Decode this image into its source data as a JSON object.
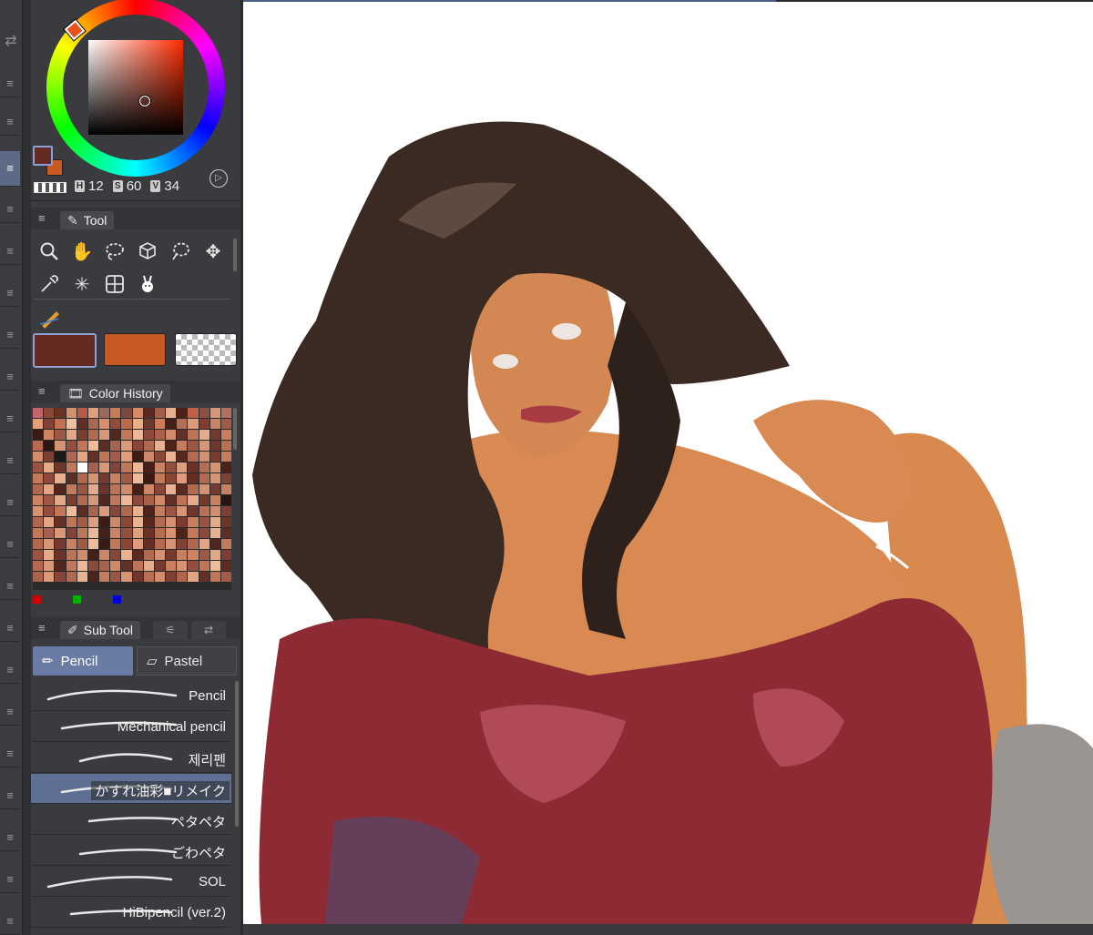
{
  "color_wheel": {
    "h_label": "H",
    "h_value": "12",
    "s_label": "S",
    "s_value": "60",
    "v_label": "V",
    "v_value": "34",
    "main_color": "#652b22",
    "sub_color": "#c85a26"
  },
  "tool_panel": {
    "tab_label": "Tool",
    "tools": [
      "zoom-icon",
      "hand-icon",
      "lasso-select-icon",
      "3d-object-icon",
      "lasso-fill-icon",
      "move-icon",
      "eyedropper-icon",
      "auto-select-icon",
      "frame-border-icon",
      "rabbit-icon"
    ]
  },
  "color_history": {
    "tab_label": "Color History",
    "swatches": [
      "#c2666c",
      "#8a4a3a",
      "#6b3326",
      "#d4906a",
      "#b85a48",
      "#e0a080",
      "#9a6b5c",
      "#c87a5a",
      "#7a4a42",
      "#d68a6a",
      "#5a2a22",
      "#a0604a",
      "#e6b090",
      "#4a2018",
      "#c06048",
      "#8e5040",
      "#d49878",
      "#b07060",
      "#e4a07a",
      "#7e4236",
      "#c27052",
      "#f0c0a0",
      "#5e3028",
      "#a86850",
      "#d8906c",
      "#924c3a",
      "#ba6a4e",
      "#e8b088",
      "#6a3a30",
      "#cc7c5c",
      "#402018",
      "#b0705a",
      "#dc9c7c",
      "#843c2e",
      "#c88666",
      "#a05a48",
      "#3a1a14",
      "#cc8462",
      "#9e5846",
      "#e0a886",
      "#7a3e32",
      "#b46a52",
      "#d6987a",
      "#52281e",
      "#c0785c",
      "#ecb898",
      "#8c4a3c",
      "#a8624c",
      "#d08a6a",
      "#60302a",
      "#bc7458",
      "#e4ac8c",
      "#743a2e",
      "#c8805e",
      "#b86a50",
      "#2e1612",
      "#d49474",
      "#924e3e",
      "#c27656",
      "#f0bc98",
      "#5a2c24",
      "#a6644e",
      "#da9a7a",
      "#88463a",
      "#b0684e",
      "#e6b292",
      "#4c241c",
      "#c47c5e",
      "#9c5646",
      "#d69676",
      "#6e362c",
      "#ba7052",
      "#d28e6c",
      "#7c4034",
      "#1a1a1a",
      "#ae664e",
      "#e2a684",
      "#643026",
      "#c07656",
      "#a25c48",
      "#de9e7e",
      "#3e1c16",
      "#cc8868",
      "#8a4838",
      "#e8b494",
      "#56281e",
      "#b26c54",
      "#d49070",
      "#7a3c30",
      "#c4805e",
      "#9a5242",
      "#e2aa88",
      "#6c362a",
      "#c07a5a",
      "#ffffff",
      "#a46050",
      "#d89878",
      "#80423a",
      "#bc7658",
      "#eab898",
      "#46201a",
      "#c88464",
      "#92503e",
      "#dca080",
      "#683228",
      "#b66e52",
      "#d89472",
      "#4a2418",
      "#c27a5a",
      "#8c4a3c",
      "#e6b08e",
      "#5c2e26",
      "#b0684e",
      "#d49676",
      "#763a30",
      "#c88262",
      "#a05a46",
      "#ecbc9c",
      "#3a1a14",
      "#c07858",
      "#8a4636",
      "#de9c7c",
      "#622e26",
      "#b46a50",
      "#d69474",
      "#7e4236",
      "#ae6850",
      "#e0a482",
      "#52261e",
      "#c27c5c",
      "#9a5444",
      "#e4aa8a",
      "#6a342a",
      "#bc7456",
      "#d08c6c",
      "#442018",
      "#cc8666",
      "#884638",
      "#e8b292",
      "#5a2a22",
      "#b06a52",
      "#d49272",
      "#743a2e",
      "#c48060",
      "#cc8462",
      "#9e5846",
      "#e0a886",
      "#7a3e32",
      "#b46a52",
      "#d6987a",
      "#52281e",
      "#c0785c",
      "#ecb898",
      "#8c4a3c",
      "#a8624c",
      "#d08a6a",
      "#60302a",
      "#bc7458",
      "#e4ac8c",
      "#743a2e",
      "#c8805e",
      "#2a1410",
      "#d49474",
      "#924e3e",
      "#c27656",
      "#f0bc98",
      "#5a2c24",
      "#a6644e",
      "#da9a7a",
      "#88463a",
      "#b0684e",
      "#e6b292",
      "#4c241c",
      "#c47c5e",
      "#9c5646",
      "#d69676",
      "#6e362c",
      "#ba7052",
      "#d28e6c",
      "#7c4034",
      "#ae664e",
      "#e2a684",
      "#643026",
      "#c07656",
      "#a25c48",
      "#de9e7e",
      "#3e1c16",
      "#cc8868",
      "#8a4838",
      "#e8b494",
      "#56281e",
      "#b26c54",
      "#d49070",
      "#7a3c30",
      "#c4805e",
      "#9a5242",
      "#e2aa88",
      "#6c362a",
      "#c07a5a",
      "#a46050",
      "#d89878",
      "#80423a",
      "#bc7658",
      "#eab898",
      "#46201a",
      "#c88464",
      "#92503e",
      "#dca080",
      "#683228",
      "#b66e52",
      "#d89472",
      "#4a2418",
      "#c27a5a",
      "#8c4a3c",
      "#e6b08e",
      "#5c2e26",
      "#b0684e",
      "#d49676",
      "#763a30",
      "#c88262",
      "#a05a46",
      "#ecbc9c",
      "#3a1a14",
      "#c07858",
      "#8a4636",
      "#de9c7c",
      "#622e26",
      "#b46a50",
      "#d69474",
      "#7e4236",
      "#ae6850",
      "#e0a482",
      "#52261e",
      "#c27c5c",
      "#9a5444",
      "#e4aa8a",
      "#6a342a",
      "#bc7456",
      "#d08c6c",
      "#442018",
      "#cc8666",
      "#884638",
      "#e8b292",
      "#5a2a22",
      "#b06a52",
      "#d49272",
      "#743a2e",
      "#c48060",
      "#cc8462",
      "#9e5846",
      "#e0a886",
      "#7a3e32",
      "#b46a52",
      "#d6987a",
      "#52281e",
      "#c0785c",
      "#ecb898",
      "#8c4a3c",
      "#a8624c",
      "#d08a6a",
      "#60302a",
      "#bc7458",
      "#e4ac8c",
      "#743a2e",
      "#c8805e",
      "#d49474",
      "#924e3e",
      "#c27656",
      "#f0bc98",
      "#5a2c24",
      "#a6644e",
      "#da9a7a",
      "#88463a",
      "#b0684e",
      "#e6b292",
      "#4c241c",
      "#c47c5e",
      "#9c5646",
      "#d69676",
      "#6e362c",
      "#ba7052",
      "#d28e6c",
      "#7c4034",
      "#ae664e",
      "#e2a684",
      "#643026",
      "#c07656",
      "#a25c48"
    ],
    "rgb_markers": [
      "#d00000",
      "#00b000",
      "#0000e0"
    ]
  },
  "sub_tool": {
    "tab_label": "Sub Tool",
    "groups": [
      {
        "label": "Pencil",
        "active": true
      },
      {
        "label": "Pastel",
        "active": false
      }
    ],
    "brushes": [
      {
        "name": "Pencil",
        "selected": false
      },
      {
        "name": "Mechanical pencil",
        "selected": false
      },
      {
        "name": "제리펜",
        "selected": false
      },
      {
        "name": "かすれ油彩■リメイク",
        "selected": true
      },
      {
        "name": "ペタペタ",
        "selected": false
      },
      {
        "name": "ごわペタ",
        "selected": false
      },
      {
        "name": "SOL",
        "selected": false
      },
      {
        "name": "HiBipencil (ver.2)",
        "selected": false
      }
    ]
  },
  "canvas": {
    "background": "#ffffff"
  }
}
